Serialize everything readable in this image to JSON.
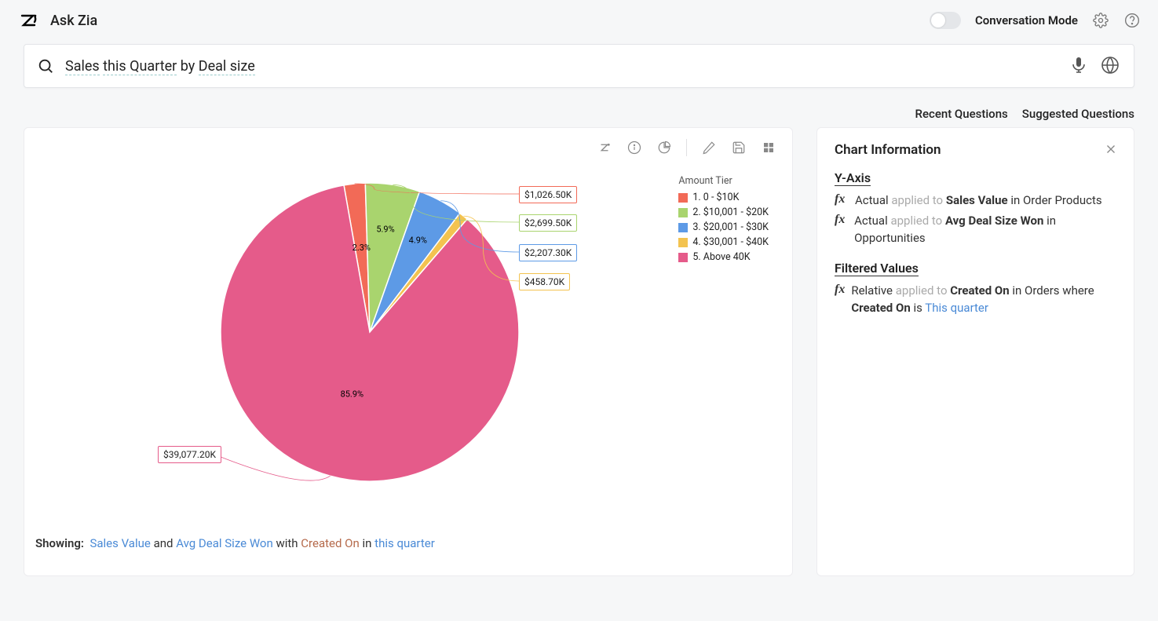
{
  "header": {
    "app_title": "Ask Zia",
    "conversation_mode_label": "Conversation Mode",
    "conversation_mode_on": false
  },
  "search": {
    "query_parts": {
      "sales": "Sales",
      "this_quarter": "this Quarter",
      "by": "by",
      "deal_size": "Deal size"
    }
  },
  "subheader": {
    "recent": "Recent Questions",
    "suggested": "Suggested Questions"
  },
  "chart_data": {
    "type": "pie",
    "legend_title": "Amount Tier",
    "series": [
      {
        "name": "1. 0 - $10K",
        "color": "#f26a57",
        "percent": 2.3,
        "value_label": "$1,026.50K"
      },
      {
        "name": "2. $10,001 - $20K",
        "color": "#a9d46e",
        "percent": 5.9,
        "value_label": "$2,699.50K"
      },
      {
        "name": "3. $20,001 - $30K",
        "color": "#5d9ae6",
        "percent": 4.9,
        "value_label": "$2,207.30K"
      },
      {
        "name": "4. $30,001 - $40K",
        "color": "#f3c350",
        "percent": 1.0,
        "value_label": "$458.70K"
      },
      {
        "name": "5. Above 40K",
        "color": "#e55b8a",
        "percent": 85.9,
        "value_label": "$39,077.20K"
      }
    ]
  },
  "showing": {
    "label": "Showing:",
    "sales_value": "Sales Value",
    "and": "and",
    "avg_deal": "Avg Deal Size Won",
    "with": "with",
    "created_on": "Created On",
    "in": "in",
    "this_quarter": "this quarter"
  },
  "info": {
    "title": "Chart Information",
    "yaxis_title": "Y-Axis",
    "yaxis": [
      {
        "func": "Actual",
        "applied": "applied to",
        "target": "Sales Value",
        "in": "in",
        "source": "Order Products"
      },
      {
        "func": "Actual",
        "applied": "applied to",
        "target": "Avg Deal Size Won",
        "in": "in",
        "source": "Opportunities"
      }
    ],
    "filtered_title": "Filtered Values",
    "filtered": {
      "func": "Relative",
      "applied": "applied to",
      "target": "Created On",
      "in": "in",
      "source": "Orders",
      "where": "where",
      "field": "Created On",
      "is": "is",
      "value": "This quarter"
    }
  }
}
